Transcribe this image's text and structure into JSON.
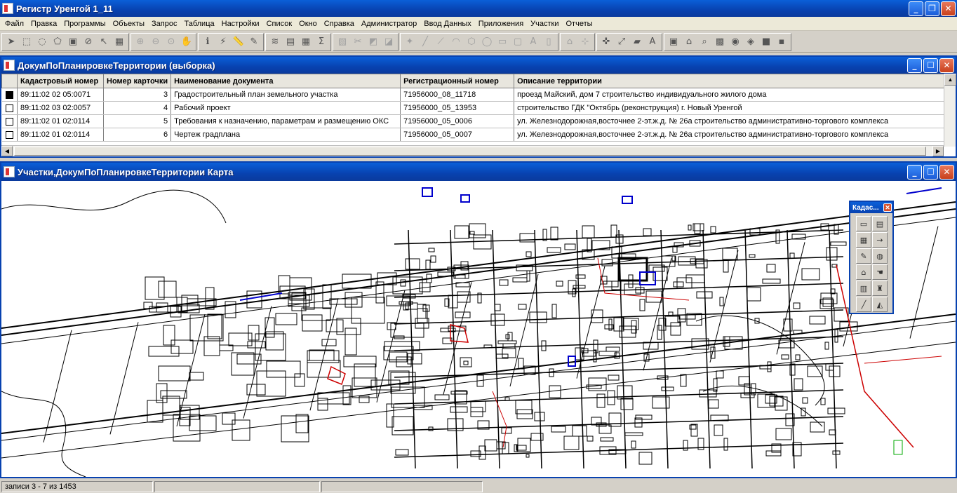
{
  "app": {
    "title": "Регистр Уренгой 1_11"
  },
  "menu": [
    "Файл",
    "Правка",
    "Программы",
    "Объекты",
    "Запрос",
    "Таблица",
    "Настройки",
    "Список",
    "Окно",
    "Справка",
    "Администратор",
    "Ввод Данных",
    "Приложения",
    "Участки",
    "Отчеты"
  ],
  "toolbar_groups": [
    [
      "arrow-select-icon",
      "marquee-select-icon",
      "radius-select-icon",
      "polygon-select-icon",
      "boundary-select-icon",
      "unselect-icon",
      "invert-select-icon",
      "graph-select-icon"
    ],
    [
      "zoom-in-icon",
      "zoom-out-icon",
      "change-view-icon",
      "pan-hand-icon"
    ],
    [
      "info-icon",
      "hotlink-icon",
      "ruler-icon",
      "label-icon"
    ],
    [
      "layer-control-icon",
      "layout-icon",
      "browser-icon",
      "statistics-icon"
    ],
    [
      "legend-icon",
      "clip-icon",
      "thematic-icon",
      "redistrict-icon"
    ],
    [
      "symbol-icon",
      "line-icon",
      "polyline-icon",
      "arc-icon",
      "polygon-icon",
      "ellipse-icon",
      "rectangle-icon",
      "rounded-rect-icon",
      "text-icon",
      "frame-icon"
    ],
    [
      "reshape-icon",
      "add-node-icon"
    ],
    [
      "geolocate-icon",
      "measure-icon",
      "map-folder-icon",
      "font-icon"
    ],
    [
      "book-icon",
      "cap-icon",
      "query-icon",
      "photo-icon",
      "eye-icon",
      "layers-icon",
      "stack-icon",
      "save-icon"
    ]
  ],
  "table_window": {
    "title": "ДокумПоПланировкеТерритории (выборка)",
    "columns": [
      "Кадастровый номер",
      "Номер карточки",
      "Наименование документа",
      "Регистрационный номер",
      "Описание территории"
    ],
    "rows": [
      {
        "selected": true,
        "cad": "89:11:02 02 05:0071",
        "card": "3",
        "doc": "Градостроительный план земельного участка",
        "reg": "71956000_08_11718",
        "desc": "проезд Майский, дом 7 строительство индивидуального жилого дома"
      },
      {
        "selected": false,
        "cad": "89:11:02 03 02:0057",
        "card": "4",
        "doc": "Рабочий проект",
        "reg": "71956000_05_13953",
        "desc": "строительство ГДК \"Октябрь (реконструкция) г. Новый Уренгой"
      },
      {
        "selected": false,
        "cad": "89:11:02 01 02:0114",
        "card": "5",
        "doc": "Требования к назначению, параметрам и размещению ОКС",
        "reg": "71956000_05_0006",
        "desc": "ул. Железнодорожная,восточнее 2-эт.ж.д. № 26а строительство административно-торгового комплекса"
      },
      {
        "selected": false,
        "cad": "89:11:02 01 02:0114",
        "card": "6",
        "doc": "Чертеж градплана",
        "reg": "71956000_05_0007",
        "desc": "ул. Железнодорожная,восточнее 2-эт.ж.д. № 26а строительство административно-торгового комплекса"
      }
    ]
  },
  "map_window": {
    "title": "Участки,ДокумПоПланировкеТерритории Карта"
  },
  "palette": {
    "title": "Кадас...",
    "buttons": [
      "window-icon",
      "table-icon",
      "grid-icon",
      "arrow-right-icon",
      "pencil-icon",
      "globe-icon",
      "house-icon",
      "hand-icon",
      "building-icon",
      "tower-icon",
      "line-tool-icon",
      "cadastre-icon"
    ]
  },
  "colors": {
    "titlebar": "#0842b0",
    "map_red": "#cc0000",
    "map_blue": "#0000cc",
    "map_green": "#00aa00"
  },
  "status": {
    "records": "записи 3 - 7 из 1453",
    "panel2": "",
    "panel3": ""
  }
}
